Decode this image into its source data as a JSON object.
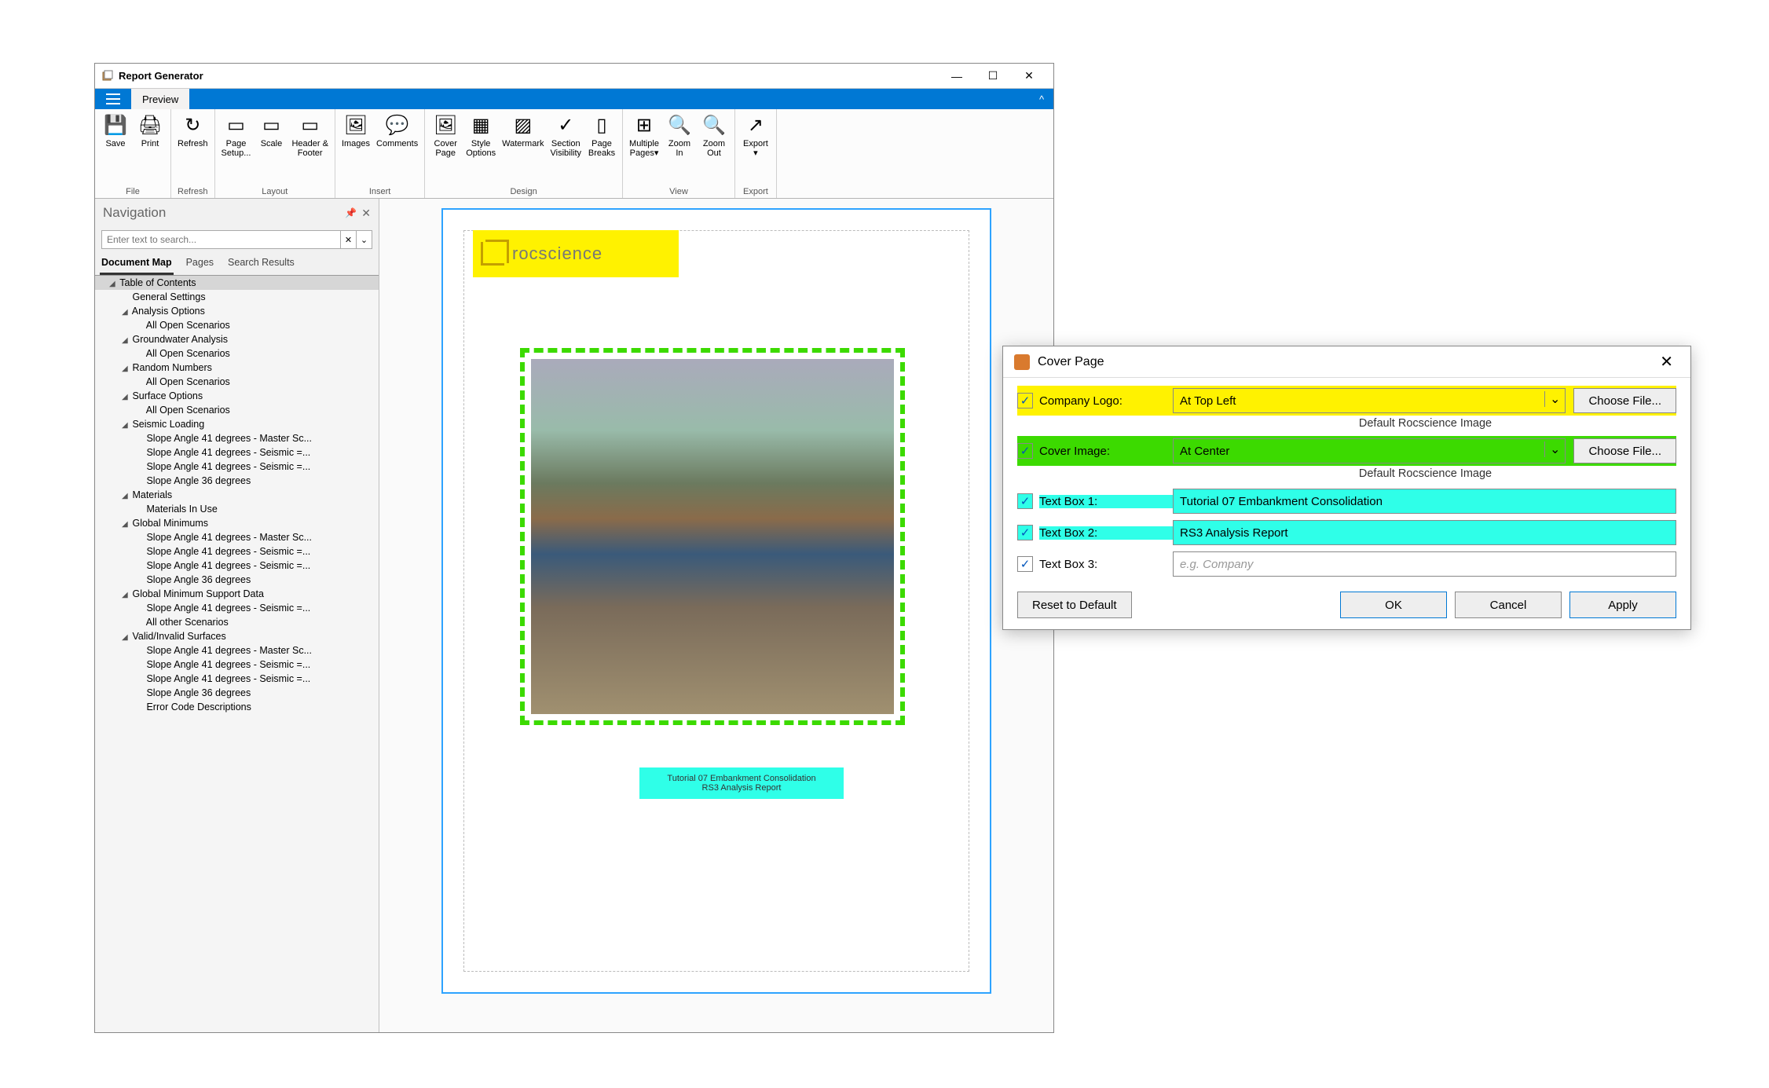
{
  "window": {
    "title": "Report Generator",
    "tab": "Preview"
  },
  "ribbon": {
    "groups": [
      {
        "label": "File",
        "items": [
          {
            "id": "save-button",
            "label": "Save",
            "glyph": "💾"
          },
          {
            "id": "print-button",
            "label": "Print",
            "glyph": "🖨"
          }
        ]
      },
      {
        "label": "Refresh",
        "items": [
          {
            "id": "refresh-button",
            "label": "Refresh",
            "glyph": "↻"
          }
        ]
      },
      {
        "label": "Layout",
        "items": [
          {
            "id": "page-setup-button",
            "label": "Page\nSetup...",
            "glyph": "▭"
          },
          {
            "id": "scale-button",
            "label": "Scale",
            "glyph": "▭"
          },
          {
            "id": "header-footer-button",
            "label": "Header &\nFooter",
            "glyph": "▭"
          }
        ]
      },
      {
        "label": "Insert",
        "items": [
          {
            "id": "images-button",
            "label": "Images",
            "glyph": "🖼"
          },
          {
            "id": "comments-button",
            "label": "Comments",
            "glyph": "💬"
          }
        ]
      },
      {
        "label": "Design",
        "items": [
          {
            "id": "cover-page-button",
            "label": "Cover\nPage",
            "glyph": "🖼"
          },
          {
            "id": "style-options-button",
            "label": "Style\nOptions",
            "glyph": "▦"
          },
          {
            "id": "watermark-button",
            "label": "Watermark",
            "glyph": "▨"
          },
          {
            "id": "section-visibility-button",
            "label": "Section\nVisibility",
            "glyph": "✓"
          },
          {
            "id": "page-breaks-button",
            "label": "Page\nBreaks",
            "glyph": "▯"
          }
        ]
      },
      {
        "label": "View",
        "items": [
          {
            "id": "multiple-pages-button",
            "label": "Multiple\nPages▾",
            "glyph": "⊞"
          },
          {
            "id": "zoom-in-button",
            "label": "Zoom\nIn",
            "glyph": "🔍"
          },
          {
            "id": "zoom-out-button",
            "label": "Zoom\nOut",
            "glyph": "🔍"
          }
        ]
      },
      {
        "label": "Export",
        "items": [
          {
            "id": "export-button",
            "label": "Export\n▾",
            "glyph": "↗"
          }
        ]
      }
    ]
  },
  "nav": {
    "title": "Navigation",
    "search_placeholder": "Enter text to search...",
    "tabs": [
      "Document Map",
      "Pages",
      "Search Results"
    ],
    "tree": [
      {
        "d": 1,
        "exp": "◢",
        "txt": "Table of Contents",
        "sel": true
      },
      {
        "d": 2,
        "exp": "",
        "txt": "General Settings"
      },
      {
        "d": 2,
        "exp": "◢",
        "txt": "Analysis Options"
      },
      {
        "d": 3,
        "exp": "",
        "txt": "All Open Scenarios"
      },
      {
        "d": 2,
        "exp": "◢",
        "txt": "Groundwater Analysis"
      },
      {
        "d": 3,
        "exp": "",
        "txt": "All Open Scenarios"
      },
      {
        "d": 2,
        "exp": "◢",
        "txt": "Random Numbers"
      },
      {
        "d": 3,
        "exp": "",
        "txt": "All Open Scenarios"
      },
      {
        "d": 2,
        "exp": "◢",
        "txt": "Surface Options"
      },
      {
        "d": 3,
        "exp": "",
        "txt": "All Open Scenarios"
      },
      {
        "d": 2,
        "exp": "◢",
        "txt": "Seismic Loading"
      },
      {
        "d": 3,
        "exp": "",
        "txt": "Slope Angle 41 degrees - Master Sc..."
      },
      {
        "d": 3,
        "exp": "",
        "txt": "Slope Angle 41 degrees - Seismic =..."
      },
      {
        "d": 3,
        "exp": "",
        "txt": "Slope Angle 41 degrees - Seismic =..."
      },
      {
        "d": 3,
        "exp": "",
        "txt": "Slope Angle 36 degrees"
      },
      {
        "d": 2,
        "exp": "◢",
        "txt": "Materials"
      },
      {
        "d": 3,
        "exp": "",
        "txt": "Materials In Use"
      },
      {
        "d": 2,
        "exp": "◢",
        "txt": "Global Minimums"
      },
      {
        "d": 3,
        "exp": "",
        "txt": "Slope Angle 41 degrees - Master Sc..."
      },
      {
        "d": 3,
        "exp": "",
        "txt": "Slope Angle 41 degrees - Seismic =..."
      },
      {
        "d": 3,
        "exp": "",
        "txt": "Slope Angle 41 degrees - Seismic =..."
      },
      {
        "d": 3,
        "exp": "",
        "txt": "Slope Angle 36 degrees"
      },
      {
        "d": 2,
        "exp": "◢",
        "txt": "Global Minimum Support Data"
      },
      {
        "d": 3,
        "exp": "",
        "txt": "Slope Angle 41 degrees - Seismic =..."
      },
      {
        "d": 3,
        "exp": "",
        "txt": "All other Scenarios"
      },
      {
        "d": 2,
        "exp": "◢",
        "txt": "Valid/Invalid Surfaces"
      },
      {
        "d": 3,
        "exp": "",
        "txt": "Slope Angle 41 degrees - Master Sc..."
      },
      {
        "d": 3,
        "exp": "",
        "txt": "Slope Angle 41 degrees - Seismic =..."
      },
      {
        "d": 3,
        "exp": "",
        "txt": "Slope Angle 41 degrees - Seismic =..."
      },
      {
        "d": 3,
        "exp": "",
        "txt": "Slope Angle 36 degrees"
      },
      {
        "d": 3,
        "exp": "",
        "txt": "Error Code Descriptions"
      }
    ]
  },
  "preview": {
    "logo_text": "rocscience",
    "text1": "Tutorial 07 Embankment Consolidation",
    "text2": "RS3 Analysis Report"
  },
  "dialog": {
    "title": "Cover Page",
    "rows": {
      "logo": {
        "label": "Company Logo:",
        "value": "At Top Left",
        "sub": "Default Rocscience Image",
        "choose": "Choose File..."
      },
      "cover": {
        "label": "Cover Image:",
        "value": "At Center",
        "sub": "Default Rocscience Image",
        "choose": "Choose File..."
      },
      "t1": {
        "label": "Text Box 1:",
        "value": "Tutorial 07 Embankment Consolidation"
      },
      "t2": {
        "label": "Text Box 2:",
        "value": "RS3 Analysis Report"
      },
      "t3": {
        "label": "Text Box 3:",
        "placeholder": "e.g. Company"
      }
    },
    "buttons": {
      "reset": "Reset to Default",
      "ok": "OK",
      "cancel": "Cancel",
      "apply": "Apply"
    }
  }
}
